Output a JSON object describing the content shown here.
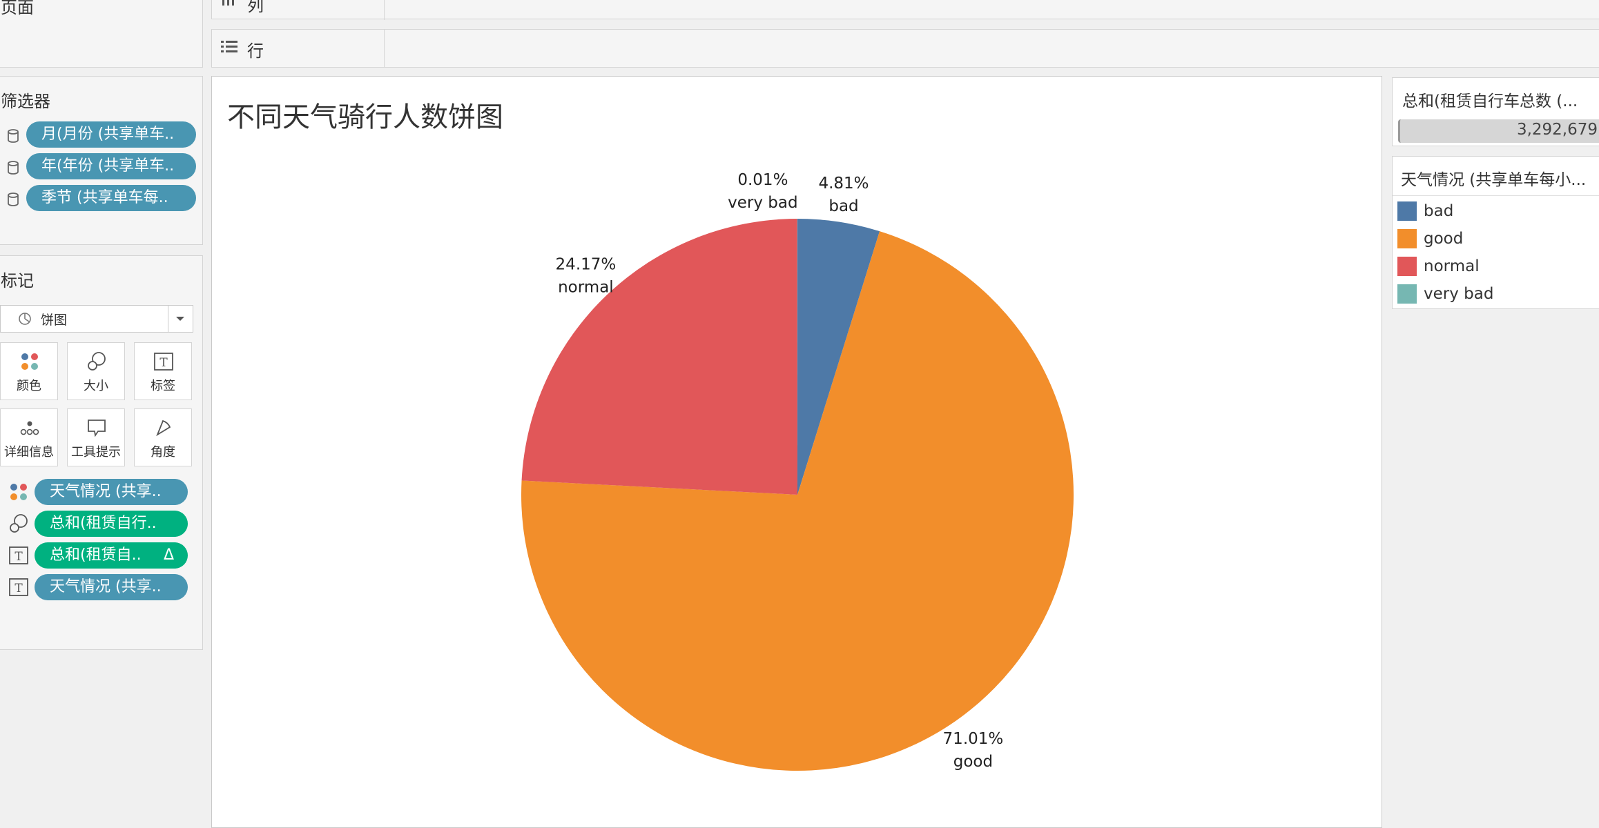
{
  "sidebar": {
    "pages_title": "页面",
    "filters_title": "筛选器",
    "filters": [
      "月(月份 (共享单车..",
      "年(年份 (共享单车..",
      "季节 (共享单车每.."
    ],
    "marks_title": "标记",
    "mark_type": "饼图",
    "mark_buttons": [
      "颜色",
      "大小",
      "标签",
      "详细信息",
      "工具提示",
      "角度"
    ],
    "mark_fields": [
      {
        "label": "天气情况 (共享..",
        "icon": "color-dots-icon",
        "color": "#4996b2"
      },
      {
        "label": "总和(租赁自行..",
        "icon": "size-icon",
        "color": "#00b180"
      },
      {
        "label": "总和(租赁自.. ",
        "icon": "label-icon",
        "color": "#00b180",
        "delta": "Δ"
      },
      {
        "label": "天气情况 (共享..",
        "icon": "label-icon",
        "color": "#4996b2"
      }
    ]
  },
  "shelves": {
    "columns_label": "列",
    "rows_label": "行"
  },
  "sheet": {
    "title": "不同天气骑行人数饼图"
  },
  "right": {
    "size_legend_title": "总和(租赁自行车总数 (...",
    "size_legend_value": "3,292,679",
    "color_legend_title": "天气情况 (共享单车每小...",
    "legend": [
      {
        "label": "bad",
        "color": "#4e79a7"
      },
      {
        "label": "good",
        "color": "#f28e2b"
      },
      {
        "label": "normal",
        "color": "#e15759"
      },
      {
        "label": "very bad",
        "color": "#76b7b2"
      }
    ]
  },
  "chart_data": {
    "type": "pie",
    "title": "不同天气骑行人数饼图",
    "categories": [
      "bad",
      "good",
      "normal",
      "very bad"
    ],
    "values": [
      4.81,
      71.01,
      24.17,
      0.01
    ],
    "value_labels": [
      "4.81%",
      "71.01%",
      "24.17%",
      "0.01%"
    ],
    "colors": [
      "#4e79a7",
      "#f28e2b",
      "#e15759",
      "#76b7b2"
    ],
    "total": "3,292,679",
    "legend": "right"
  }
}
